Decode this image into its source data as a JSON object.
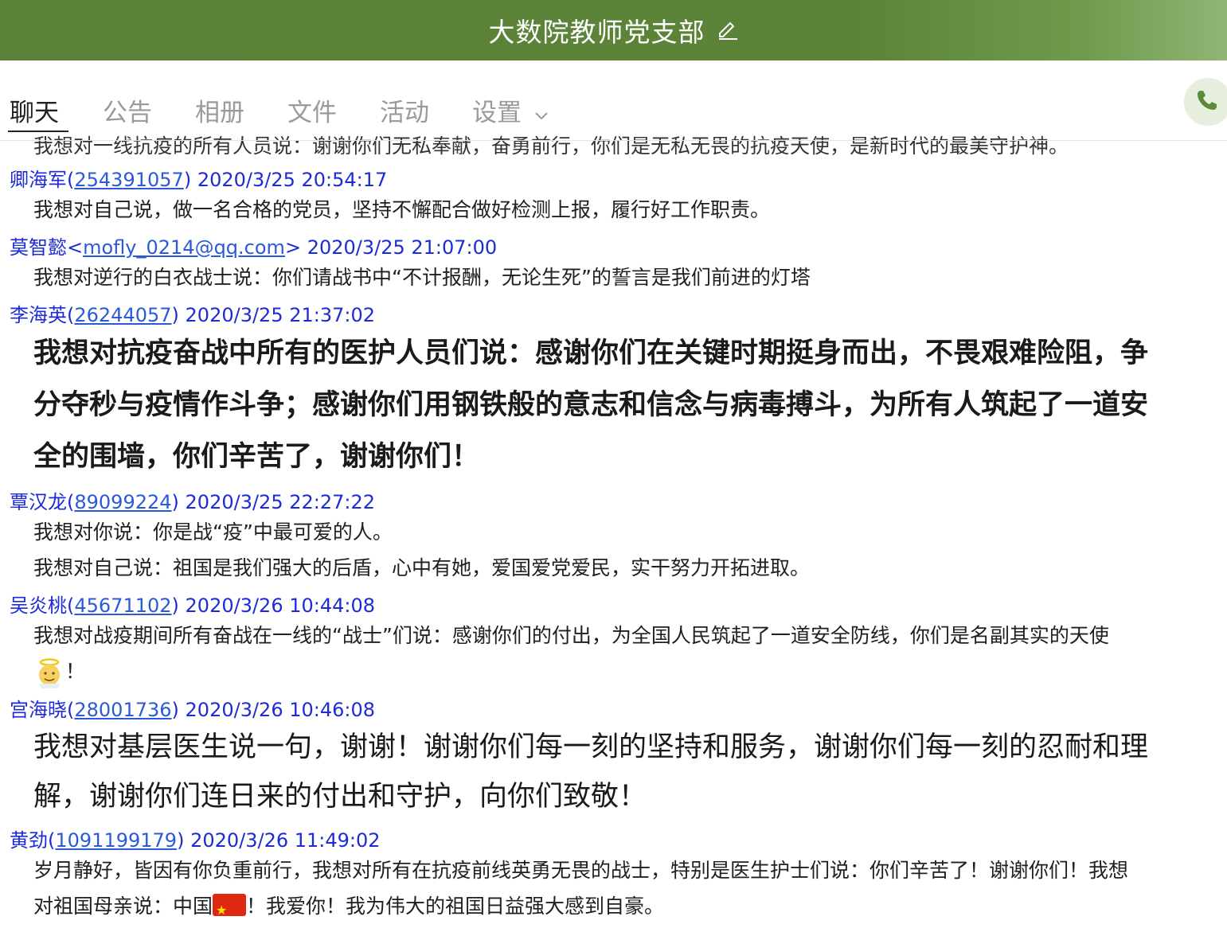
{
  "window": {
    "title": "大数院教师党支部"
  },
  "tabs": [
    {
      "label": "聊天",
      "active": true
    },
    {
      "label": "公告",
      "active": false
    },
    {
      "label": "相册",
      "active": false
    },
    {
      "label": "文件",
      "active": false
    },
    {
      "label": "活动",
      "active": false
    },
    {
      "label": "设置",
      "active": false
    }
  ],
  "clipped_line": "我想对一线抗疫的所有人员说：谢谢你们无私奉献，奋勇前行，你们是无私无畏的抗疫天使，是新时代的最美守护神。",
  "messages": [
    {
      "sender": "卿海军",
      "id": "254391057",
      "time": "2020/3/25 20:54:17",
      "lines": [
        "我想对自己说，做一名合格的党员，坚持不懈配合做好检测上报，履行好工作职责。"
      ]
    },
    {
      "sender": "莫智懿",
      "email": "mofly_0214@qq.com",
      "time": "2020/3/25 21:07:00",
      "lines": [
        "我想对逆行的白衣战士说：你们请战书中“不计报酬，无论生死”的誓言是我们前进的灯塔"
      ]
    },
    {
      "sender": "李海英",
      "id": "26244057",
      "time": "2020/3/25 21:37:02",
      "lines": [
        "我想对抗疫奋战中所有的医护人员们说：感谢你们在关键时期挺身而出，不畏艰难险阻，争",
        "分夺秒与疫情作斗争；感谢你们用钢铁般的意志和信念与病毒搏斗，为所有人筑起了一道安",
        "全的围墙，你们辛苦了，谢谢你们！"
      ]
    },
    {
      "sender": "覃汉龙",
      "id": "89099224",
      "time": "2020/3/25 22:27:22",
      "lines": [
        "我想对你说：你是战“疫”中最可爱的人。",
        "我想对自己说：祖国是我们强大的后盾，心中有她，爱国爱党爱民，实干努力开拓进取。"
      ]
    },
    {
      "sender": "吴炎桃",
      "id": "45671102",
      "time": "2020/3/26 10:44:08",
      "lines": [
        "我想对战疫期间所有奋战在一线的“战士”们说：感谢你们的付出，为全国人民筑起了一道安全防线，你们是名副其实的天使",
        "！"
      ],
      "emoji": "angel-emoji"
    },
    {
      "sender": "宫海晓",
      "id": "28001736",
      "time": "2020/3/26 10:46:08",
      "lines": [
        "我想对基层医生说一句，谢谢！谢谢你们每一刻的坚持和服务，谢谢你们每一刻的忍耐和理",
        "解，谢谢你们连日来的付出和守护，向你们致敬！"
      ]
    },
    {
      "sender": "黄劲",
      "id": "1091199179",
      "time": "2020/3/26 11:49:02",
      "lines": [
        "岁月静好，皆因有你负重前行，我想对所有在抗疫前线英勇无畏的战士，特别是医生护士们说：你们辛苦了！谢谢你们！我想",
        "对祖国母亲说：中国",
        "！我爱你！我为伟大的祖国日益强大感到自豪。"
      ],
      "emoji": "china-flag-emoji"
    }
  ]
}
